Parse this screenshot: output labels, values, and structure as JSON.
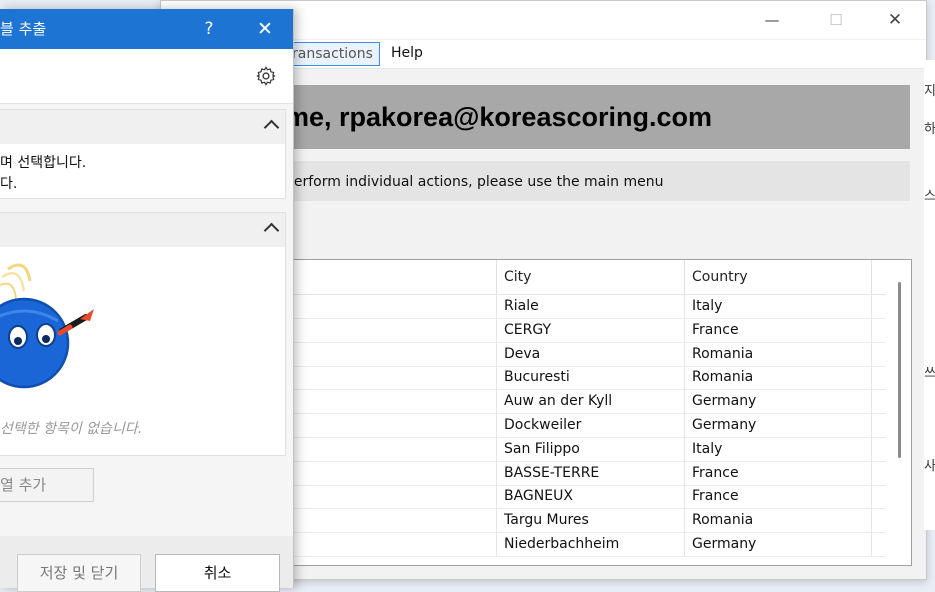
{
  "dialog": {
    "title": "블 추출",
    "help_label": "?",
    "close_label": "✕",
    "section1": {
      "line1": "며 선택합니다.",
      "line2": "다."
    },
    "empty_message": "선택한 항목이 없습니다.",
    "add_column_label": "열 추가",
    "save_close_label": "저장 및 닫기",
    "cancel_label": "취소",
    "icons": {
      "settings": "gear-icon",
      "collapse": "chevron-up-icon",
      "mascot": "robot-mascot-icon"
    }
  },
  "app": {
    "window_controls": {
      "minimize": "—",
      "maximize": "☐",
      "close": "✕"
    },
    "menu": {
      "transactions": "ransactions",
      "help": "Help"
    },
    "welcome": "me, rpakorea@koreascoring.com",
    "info": "perform individual actions, please use the main menu",
    "grid": {
      "headers": {
        "city": "City",
        "country": "Country"
      },
      "rows": [
        {
          "city": "Riale",
          "country": "Italy"
        },
        {
          "city": "CERGY",
          "country": "France"
        },
        {
          "city": "Deva",
          "country": "Romania"
        },
        {
          "city": "Bucuresti",
          "country": "Romania"
        },
        {
          "city": "Auw an der Kyll",
          "country": "Germany"
        },
        {
          "city": "Dockweiler",
          "country": "Germany"
        },
        {
          "city": "San Filippo",
          "country": "Italy"
        },
        {
          "city": "BASSE-TERRE",
          "country": "France"
        },
        {
          "city": "BAGNEUX",
          "country": "France"
        },
        {
          "city": "Targu Mures",
          "country": "Romania"
        },
        {
          "city": "Niederbachheim",
          "country": "Germany"
        }
      ]
    }
  },
  "back_window_strip": {
    "glyph1": "지",
    "glyph2": "하",
    "glyph3": "스",
    "glyph4": "쓰",
    "glyph5": "사"
  }
}
